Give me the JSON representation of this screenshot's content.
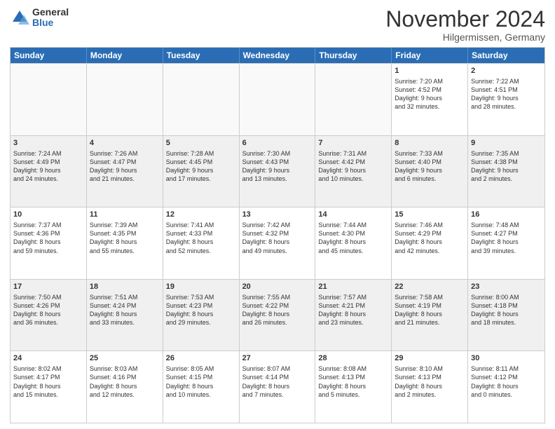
{
  "logo": {
    "general": "General",
    "blue": "Blue"
  },
  "header": {
    "month": "November 2024",
    "location": "Hilgermissen, Germany"
  },
  "days": [
    "Sunday",
    "Monday",
    "Tuesday",
    "Wednesday",
    "Thursday",
    "Friday",
    "Saturday"
  ],
  "rows": [
    [
      {
        "day": "",
        "info": "",
        "empty": true
      },
      {
        "day": "",
        "info": "",
        "empty": true
      },
      {
        "day": "",
        "info": "",
        "empty": true
      },
      {
        "day": "",
        "info": "",
        "empty": true
      },
      {
        "day": "",
        "info": "",
        "empty": true
      },
      {
        "day": "1",
        "info": "Sunrise: 7:20 AM\nSunset: 4:52 PM\nDaylight: 9 hours\nand 32 minutes.",
        "empty": false
      },
      {
        "day": "2",
        "info": "Sunrise: 7:22 AM\nSunset: 4:51 PM\nDaylight: 9 hours\nand 28 minutes.",
        "empty": false
      }
    ],
    [
      {
        "day": "3",
        "info": "Sunrise: 7:24 AM\nSunset: 4:49 PM\nDaylight: 9 hours\nand 24 minutes.",
        "empty": false
      },
      {
        "day": "4",
        "info": "Sunrise: 7:26 AM\nSunset: 4:47 PM\nDaylight: 9 hours\nand 21 minutes.",
        "empty": false
      },
      {
        "day": "5",
        "info": "Sunrise: 7:28 AM\nSunset: 4:45 PM\nDaylight: 9 hours\nand 17 minutes.",
        "empty": false
      },
      {
        "day": "6",
        "info": "Sunrise: 7:30 AM\nSunset: 4:43 PM\nDaylight: 9 hours\nand 13 minutes.",
        "empty": false
      },
      {
        "day": "7",
        "info": "Sunrise: 7:31 AM\nSunset: 4:42 PM\nDaylight: 9 hours\nand 10 minutes.",
        "empty": false
      },
      {
        "day": "8",
        "info": "Sunrise: 7:33 AM\nSunset: 4:40 PM\nDaylight: 9 hours\nand 6 minutes.",
        "empty": false
      },
      {
        "day": "9",
        "info": "Sunrise: 7:35 AM\nSunset: 4:38 PM\nDaylight: 9 hours\nand 2 minutes.",
        "empty": false
      }
    ],
    [
      {
        "day": "10",
        "info": "Sunrise: 7:37 AM\nSunset: 4:36 PM\nDaylight: 8 hours\nand 59 minutes.",
        "empty": false
      },
      {
        "day": "11",
        "info": "Sunrise: 7:39 AM\nSunset: 4:35 PM\nDaylight: 8 hours\nand 55 minutes.",
        "empty": false
      },
      {
        "day": "12",
        "info": "Sunrise: 7:41 AM\nSunset: 4:33 PM\nDaylight: 8 hours\nand 52 minutes.",
        "empty": false
      },
      {
        "day": "13",
        "info": "Sunrise: 7:42 AM\nSunset: 4:32 PM\nDaylight: 8 hours\nand 49 minutes.",
        "empty": false
      },
      {
        "day": "14",
        "info": "Sunrise: 7:44 AM\nSunset: 4:30 PM\nDaylight: 8 hours\nand 45 minutes.",
        "empty": false
      },
      {
        "day": "15",
        "info": "Sunrise: 7:46 AM\nSunset: 4:29 PM\nDaylight: 8 hours\nand 42 minutes.",
        "empty": false
      },
      {
        "day": "16",
        "info": "Sunrise: 7:48 AM\nSunset: 4:27 PM\nDaylight: 8 hours\nand 39 minutes.",
        "empty": false
      }
    ],
    [
      {
        "day": "17",
        "info": "Sunrise: 7:50 AM\nSunset: 4:26 PM\nDaylight: 8 hours\nand 36 minutes.",
        "empty": false
      },
      {
        "day": "18",
        "info": "Sunrise: 7:51 AM\nSunset: 4:24 PM\nDaylight: 8 hours\nand 33 minutes.",
        "empty": false
      },
      {
        "day": "19",
        "info": "Sunrise: 7:53 AM\nSunset: 4:23 PM\nDaylight: 8 hours\nand 29 minutes.",
        "empty": false
      },
      {
        "day": "20",
        "info": "Sunrise: 7:55 AM\nSunset: 4:22 PM\nDaylight: 8 hours\nand 26 minutes.",
        "empty": false
      },
      {
        "day": "21",
        "info": "Sunrise: 7:57 AM\nSunset: 4:21 PM\nDaylight: 8 hours\nand 23 minutes.",
        "empty": false
      },
      {
        "day": "22",
        "info": "Sunrise: 7:58 AM\nSunset: 4:19 PM\nDaylight: 8 hours\nand 21 minutes.",
        "empty": false
      },
      {
        "day": "23",
        "info": "Sunrise: 8:00 AM\nSunset: 4:18 PM\nDaylight: 8 hours\nand 18 minutes.",
        "empty": false
      }
    ],
    [
      {
        "day": "24",
        "info": "Sunrise: 8:02 AM\nSunset: 4:17 PM\nDaylight: 8 hours\nand 15 minutes.",
        "empty": false
      },
      {
        "day": "25",
        "info": "Sunrise: 8:03 AM\nSunset: 4:16 PM\nDaylight: 8 hours\nand 12 minutes.",
        "empty": false
      },
      {
        "day": "26",
        "info": "Sunrise: 8:05 AM\nSunset: 4:15 PM\nDaylight: 8 hours\nand 10 minutes.",
        "empty": false
      },
      {
        "day": "27",
        "info": "Sunrise: 8:07 AM\nSunset: 4:14 PM\nDaylight: 8 hours\nand 7 minutes.",
        "empty": false
      },
      {
        "day": "28",
        "info": "Sunrise: 8:08 AM\nSunset: 4:13 PM\nDaylight: 8 hours\nand 5 minutes.",
        "empty": false
      },
      {
        "day": "29",
        "info": "Sunrise: 8:10 AM\nSunset: 4:13 PM\nDaylight: 8 hours\nand 2 minutes.",
        "empty": false
      },
      {
        "day": "30",
        "info": "Sunrise: 8:11 AM\nSunset: 4:12 PM\nDaylight: 8 hours\nand 0 minutes.",
        "empty": false
      }
    ]
  ]
}
